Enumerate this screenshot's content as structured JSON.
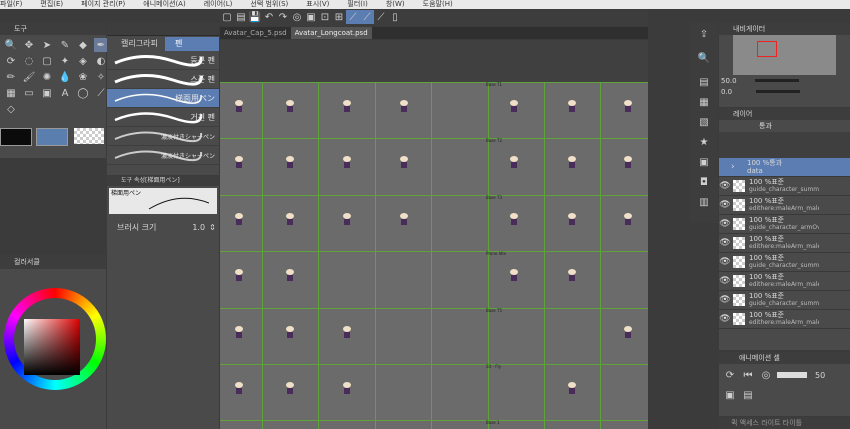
{
  "menu": [
    "파일(F)",
    "편집(E)",
    "페이지 관리(P)",
    "애니메이션(A)",
    "레이어(L)",
    "선택 범위(S)",
    "표시(V)",
    "필터(I)",
    "창(W)",
    "도움말(H)"
  ],
  "tool_panel": {
    "title": "도구"
  },
  "subtool_tabs": [
    "캘리그라피",
    "펜"
  ],
  "brushes": [
    "둥근 펜",
    "스푼 펜",
    "梯面用ペン",
    "거친 펜",
    "濃淡付きシャーペン",
    "濃淡付きシャーペン"
  ],
  "tool_property": {
    "title": "도구 속성[梯面用ペン]",
    "preset": "梯面用ペン",
    "brush_size_label": "브러시 크기",
    "brush_size": "1.0"
  },
  "color_circle": {
    "title": "컬러서클"
  },
  "documents": [
    "Avatar_Cap_5.psd",
    "Avatar_Longcoat.psd"
  ],
  "navigator": {
    "title": "내비게이터",
    "zoom": "50.0",
    "angle": "0.0"
  },
  "layer_panel": {
    "title": "레이어",
    "blend_mode": "통과",
    "folder": {
      "opacity_mode": "100 %통과",
      "name": "data"
    },
    "layers": [
      {
        "mode": "100 %표준",
        "name": "guide_character_summa"
      },
      {
        "mode": "100 %표준",
        "name": "edithere:maleArm_maleArmL"
      },
      {
        "mode": "100 %표준",
        "name": "guide_character_armOve"
      },
      {
        "mode": "100 %표준",
        "name": "edithere:maleArm_maleArmO"
      },
      {
        "mode": "100 %표준",
        "name": "guide_character_summa"
      },
      {
        "mode": "100 %표준",
        "name": "edithere:maleArm_maleArm_f"
      },
      {
        "mode": "100 %표준",
        "name": "guide_character_summa"
      },
      {
        "mode": "100 %표준",
        "name": "edithere:maleArm_maleArmBi"
      }
    ]
  },
  "animation_panel": {
    "title": "애니메이션 셀",
    "frame": "50"
  },
  "bottom_tab": {
    "title": "퀵 액세스 라이트 타이틀"
  },
  "canvas": {
    "row_labels": [
      "Base T1",
      "Base T2",
      "Base T3",
      "Prone Idle",
      "Base T5",
      "Sit - Fly",
      "Base 1"
    ],
    "accent_color": "#5fa33a",
    "character_colors": {
      "head": "#f1e0c8",
      "body": "#4a2c5b"
    }
  },
  "colors": {
    "main": "#0b0b0b",
    "sub": "#5a7fae"
  }
}
